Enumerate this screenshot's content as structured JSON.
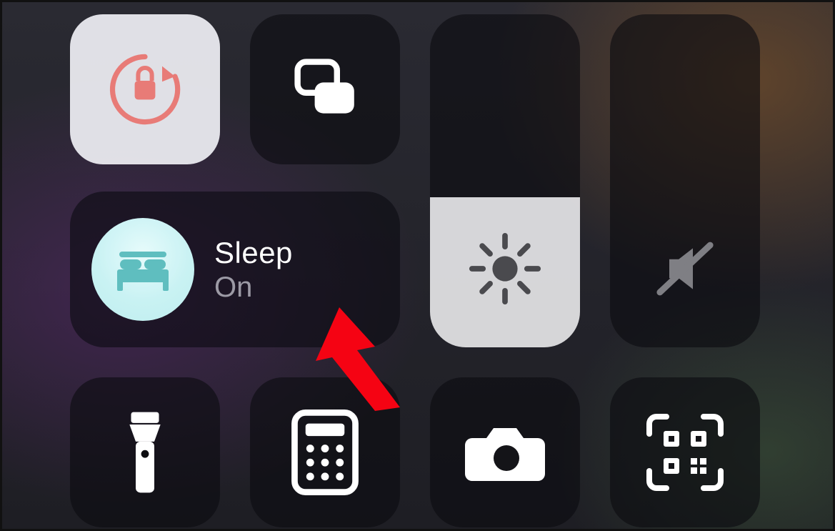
{
  "focus": {
    "title": "Sleep",
    "status": "On",
    "icon": "bed-icon"
  },
  "tiles": {
    "rotation_lock": {
      "name": "rotation-lock",
      "active": true
    },
    "screen_mirroring": {
      "name": "screen-mirroring",
      "active": false
    },
    "brightness": {
      "name": "brightness",
      "level_percent": 45
    },
    "volume": {
      "name": "volume",
      "level_percent": 0,
      "muted": true
    },
    "flashlight": {
      "name": "flashlight",
      "active": false
    },
    "calculator": {
      "name": "calculator"
    },
    "camera": {
      "name": "camera"
    },
    "qr_scanner": {
      "name": "qr-code-scanner"
    }
  },
  "annotation": {
    "type": "arrow",
    "target": "focus-tile",
    "color": "#ff0011"
  },
  "colors": {
    "accent_red": "#ed7a76",
    "accent_teal": "#5bbfc0",
    "tile_dark": "rgba(12,12,16,0.62)",
    "tile_light": "rgba(240,240,245,0.92)"
  }
}
